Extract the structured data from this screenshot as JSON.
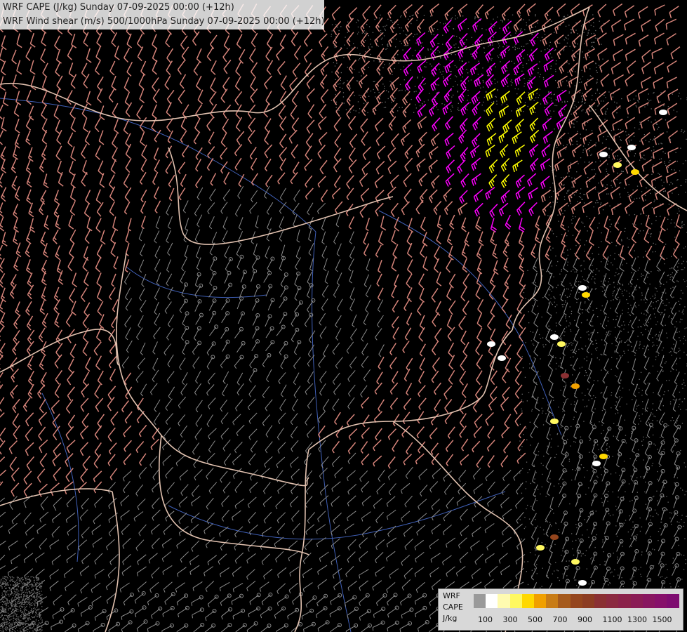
{
  "header": {
    "line1": "WRF CAPE (J/kg) Sunday 07-09-2025 00:00 (+12h)",
    "line2": "WRF Wind shear (m/s) 500/1000hPa Sunday 07-09-2025 00:00 (+12h)"
  },
  "legend": {
    "title": [
      "WRF",
      "CAPE",
      "J/kg"
    ],
    "colors": [
      "#9a9a9a",
      "#ffffff",
      "#fffbb0",
      "#fff860",
      "#ffd800",
      "#f0a000",
      "#c87c16",
      "#a55a1c",
      "#94451d",
      "#8c3c22",
      "#8a3033",
      "#8b2a40",
      "#8b224a",
      "#8a1c55",
      "#881660",
      "#86106a",
      "#7e0c70"
    ],
    "labels": [
      "100",
      "300",
      "500",
      "700",
      "900",
      "1100",
      "1300",
      "1500"
    ]
  },
  "colors": {
    "background": "#000000",
    "barb_low": "#8c8c8c",
    "barb_mid": "#d6847a",
    "barb_high": "#ff00ff",
    "barb_max": "#ffff00",
    "border_country": "#e2c2b0",
    "river": "#4060b8"
  }
}
